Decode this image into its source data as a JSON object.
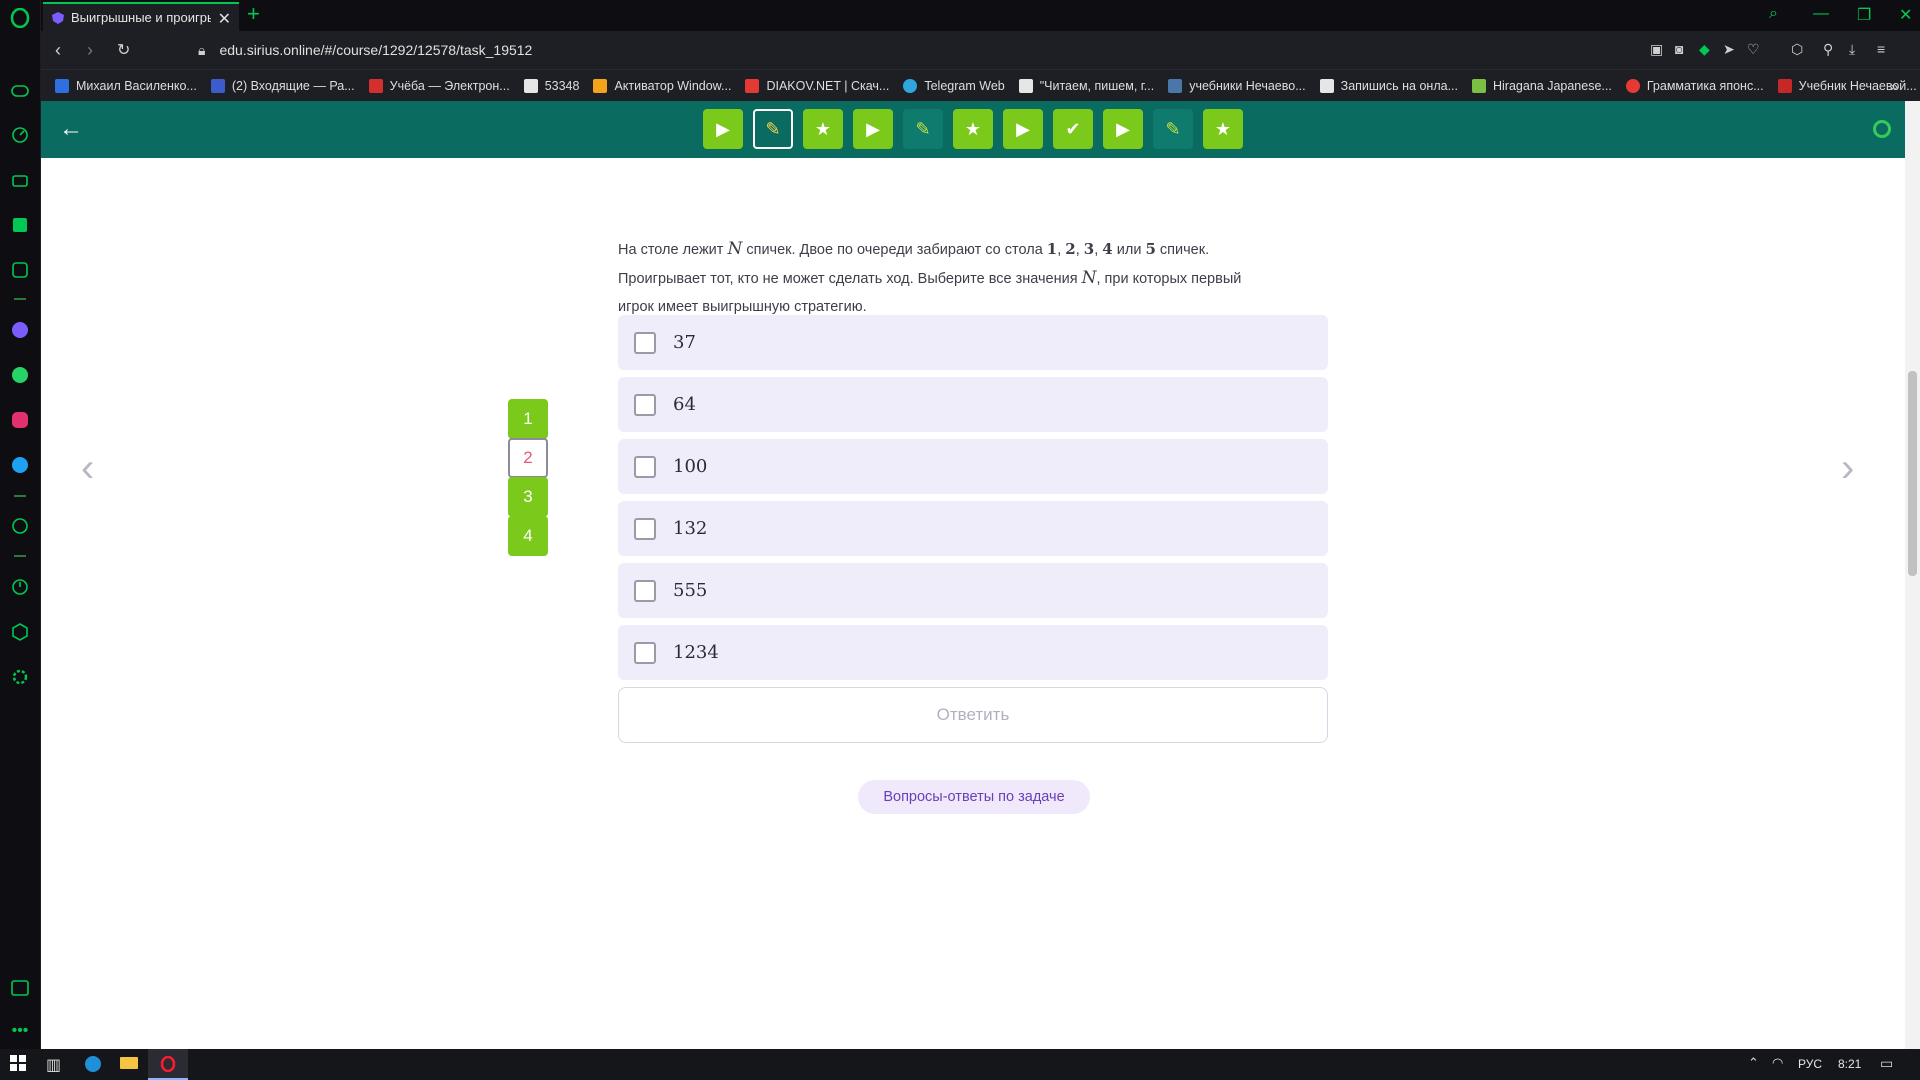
{
  "browser": {
    "tab_title": "Выигрышные и проигрыш",
    "url": "edu.sirius.online/#/course/1292/12578/task_19512",
    "bookmarks": [
      {
        "label": "Михаил Василенко...",
        "color": "#2f6fe0"
      },
      {
        "label": "(2) Входящие — Ра...",
        "color": "#3d5ccc"
      },
      {
        "label": "Учёба — Электрон...",
        "color": "#d32f2f"
      },
      {
        "label": "53348",
        "color": "#e6e6e6"
      },
      {
        "label": "Активатор Window...",
        "color": "#f3a21b"
      },
      {
        "label": "DIAKOV.NET | Скач...",
        "color": "#e53935"
      },
      {
        "label": "Telegram Web",
        "color": "#2ea6de"
      },
      {
        "label": "\"Читаем, пишем, г...",
        "color": "#e6e6e6"
      },
      {
        "label": "учебники Нечаево...",
        "color": "#4a76a8"
      },
      {
        "label": "Запишись на онла...",
        "color": "#e6e6e6"
      },
      {
        "label": "Hiragana Japanese...",
        "color": "#7ac143"
      },
      {
        "label": "Грамматика японс...",
        "color": "#e53935"
      },
      {
        "label": "Учебник Нечаевой...",
        "color": "#c62828"
      }
    ]
  },
  "appbar": {
    "steps": [
      {
        "icon": "play-icon",
        "glyph": "▶",
        "style": "green"
      },
      {
        "icon": "pencil-icon",
        "glyph": "✎",
        "style": "current"
      },
      {
        "icon": "star-icon",
        "glyph": "★",
        "style": "green"
      },
      {
        "icon": "play-icon",
        "glyph": "▶",
        "style": "green"
      },
      {
        "icon": "pencil-icon",
        "glyph": "✎",
        "style": "dark"
      },
      {
        "icon": "star-icon",
        "glyph": "★",
        "style": "green"
      },
      {
        "icon": "play-icon",
        "glyph": "▶",
        "style": "green"
      },
      {
        "icon": "check-icon",
        "glyph": "✔",
        "style": "green"
      },
      {
        "icon": "play-icon",
        "glyph": "▶",
        "style": "green"
      },
      {
        "icon": "pencil-icon",
        "glyph": "✎",
        "style": "dark"
      },
      {
        "icon": "star-icon",
        "glyph": "★",
        "style": "green"
      }
    ]
  },
  "problem": {
    "p1": "На столе лежит ",
    "var_n": "N",
    "p2": " спичек. Двое по очереди забирают со стола ",
    "n1": "1",
    "n2": "2",
    "n3": "3",
    "n4": "4",
    "or": " или ",
    "n5": "5",
    "p3": " спичек.",
    "p4": "Проигрывает тот, кто не может сделать ход. Выберите все значения ",
    "p5": ", при которых первый",
    "p6": "игрок имеет выигрышную стратегию."
  },
  "options": [
    "37",
    "64",
    "100",
    "132",
    "555",
    "1234"
  ],
  "question_numbers": [
    {
      "label": "1",
      "state": "green"
    },
    {
      "label": "2",
      "state": "current"
    },
    {
      "label": "3",
      "state": "green"
    },
    {
      "label": "4",
      "state": "green"
    }
  ],
  "answer_button": "Ответить",
  "qa_button": "Вопросы-ответы по задаче",
  "taskbar": {
    "lang": "РУС",
    "time": "8:21"
  }
}
